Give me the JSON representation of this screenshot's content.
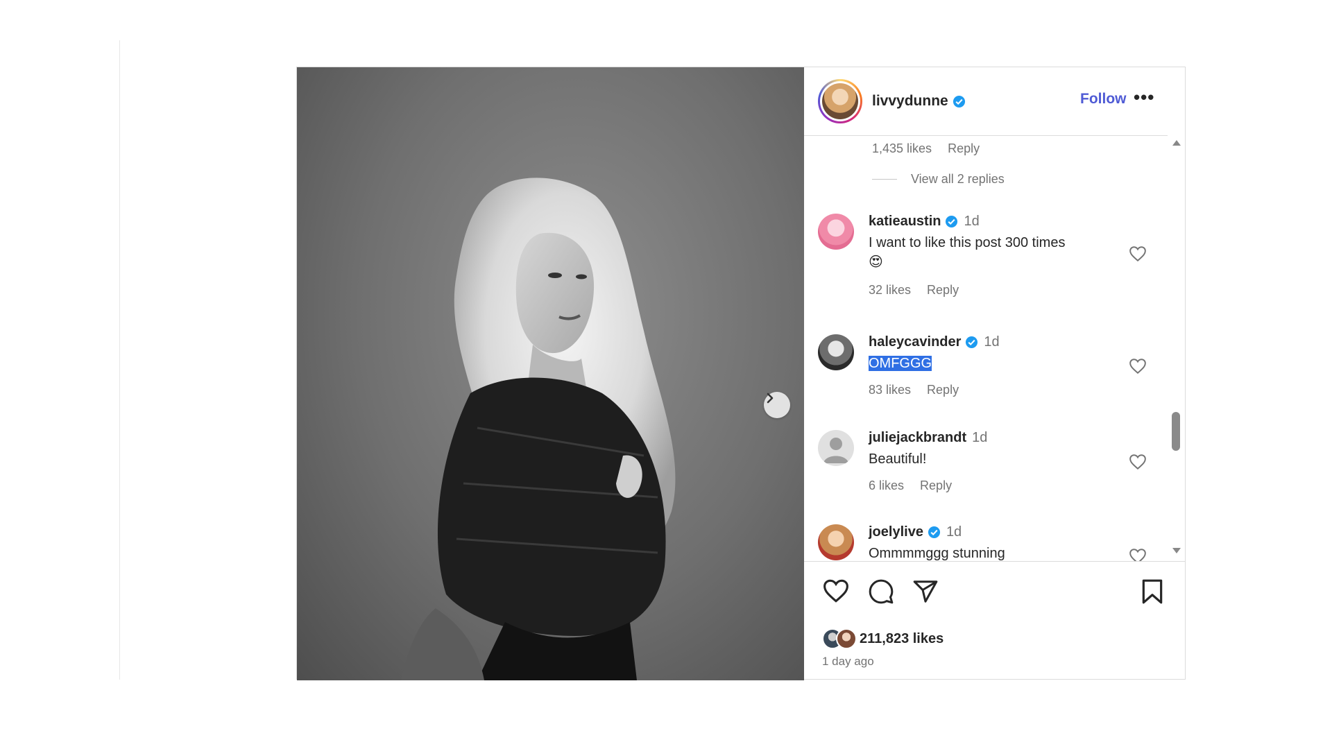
{
  "post": {
    "username": "livvydunne",
    "follow_label": "Follow",
    "more_label": "•••"
  },
  "thread": {
    "top_meta": {
      "likes": "1,435 likes",
      "reply": "Reply"
    },
    "view_replies": "View all 2 replies"
  },
  "comments": [
    {
      "user": "katieaustin",
      "verified": true,
      "time": "1d",
      "text": "I want to like this post 300 times",
      "emoji": "😍",
      "likes": "32 likes",
      "reply": "Reply"
    },
    {
      "user": "haleycavinder",
      "verified": true,
      "time": "1d",
      "text": "OMFGGG",
      "likes": "83 likes",
      "reply": "Reply"
    },
    {
      "user": "juliejackbrandt",
      "verified": false,
      "time": "1d",
      "text": "Beautiful!",
      "likes": "6 likes",
      "reply": "Reply"
    },
    {
      "user": "joelylive",
      "verified": true,
      "time": "1d",
      "text": "Ommmmggg stunning"
    }
  ],
  "footer": {
    "likes": "211,823 likes",
    "time_ago": "1 day ago"
  },
  "colors": {
    "accent": "#4f5bd5",
    "verified": "#1d9bf0",
    "highlight": "#2f6fe4",
    "muted": "#737373"
  },
  "icons": {
    "next": "chevron-right-icon",
    "like": "heart-icon",
    "comment": "speech-bubble-icon",
    "share": "paper-plane-icon",
    "save": "bookmark-icon"
  }
}
